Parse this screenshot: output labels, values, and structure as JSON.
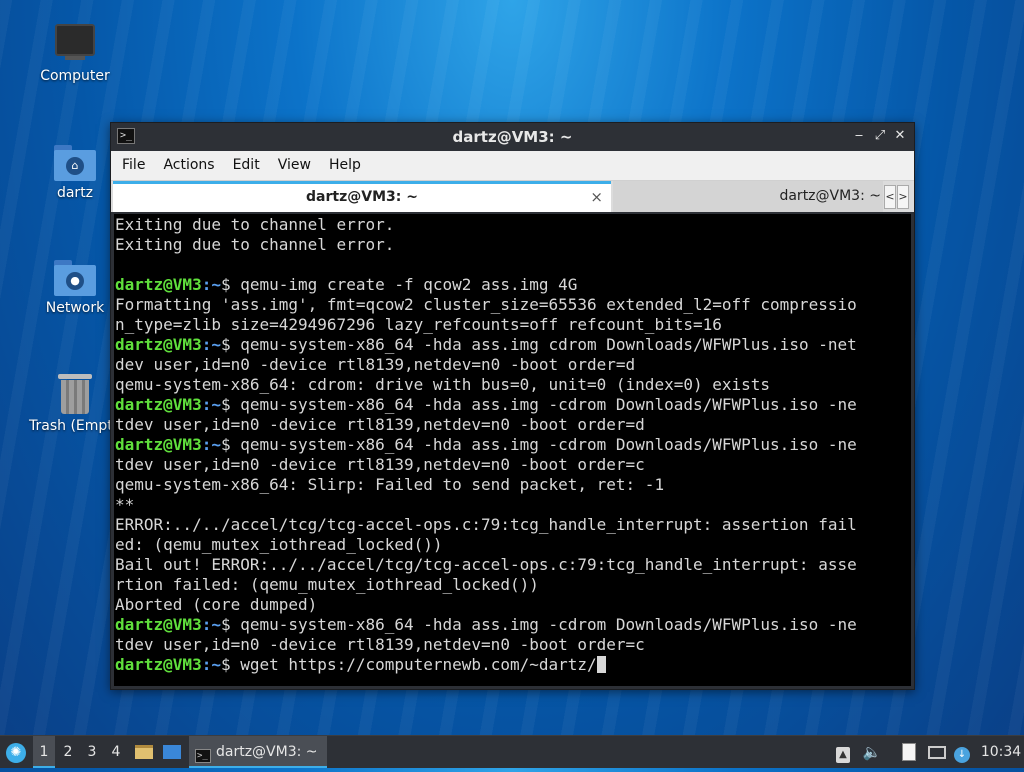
{
  "desktop": {
    "icons": [
      {
        "label": "Computer",
        "icon": "computer-icon"
      },
      {
        "label": "dartz",
        "icon": "home-folder-icon"
      },
      {
        "label": "Network",
        "icon": "network-folder-icon"
      },
      {
        "label": "Trash (Empt",
        "icon": "trash-icon"
      }
    ]
  },
  "window": {
    "title": "dartz@VM3: ~",
    "icon": "terminal-icon",
    "controls": {
      "minimize": "‒",
      "maximize": "⤢",
      "close": "✕"
    },
    "menu": [
      "File",
      "Actions",
      "Edit",
      "View",
      "Help"
    ],
    "tabs": [
      {
        "label": "dartz@VM3: ~",
        "active": true,
        "close": "×"
      },
      {
        "label": "dartz@VM3: ~",
        "active": false
      }
    ],
    "tab_scroll": {
      "left": "<",
      "right": ">"
    }
  },
  "terminal": {
    "prompt_user": "dartz@VM3",
    "prompt_path": ":~",
    "prompt_sign": "$",
    "colors": {
      "user": "#60e03c",
      "path": "#5aa0f0",
      "text": "#d7d7d7",
      "background": "#000000"
    },
    "lines": [
      {
        "type": "out",
        "text": "Exiting due to channel error."
      },
      {
        "type": "out",
        "text": "Exiting due to channel error."
      },
      {
        "type": "out",
        "text": ""
      },
      {
        "type": "cmd",
        "text": " qemu-img create -f qcow2 ass.img 4G"
      },
      {
        "type": "out",
        "text": "Formatting 'ass.img', fmt=qcow2 cluster_size=65536 extended_l2=off compressio"
      },
      {
        "type": "out",
        "text": "n_type=zlib size=4294967296 lazy_refcounts=off refcount_bits=16"
      },
      {
        "type": "cmd",
        "text": " qemu-system-x86_64 -hda ass.img cdrom Downloads/WFWPlus.iso -net"
      },
      {
        "type": "out",
        "text": "dev user,id=n0 -device rtl8139,netdev=n0 -boot order=d"
      },
      {
        "type": "out",
        "text": "qemu-system-x86_64: cdrom: drive with bus=0, unit=0 (index=0) exists"
      },
      {
        "type": "cmd",
        "text": " qemu-system-x86_64 -hda ass.img -cdrom Downloads/WFWPlus.iso -ne"
      },
      {
        "type": "out",
        "text": "tdev user,id=n0 -device rtl8139,netdev=n0 -boot order=d"
      },
      {
        "type": "cmd",
        "text": " qemu-system-x86_64 -hda ass.img -cdrom Downloads/WFWPlus.iso -ne"
      },
      {
        "type": "out",
        "text": "tdev user,id=n0 -device rtl8139,netdev=n0 -boot order=c"
      },
      {
        "type": "out",
        "text": "qemu-system-x86_64: Slirp: Failed to send packet, ret: -1"
      },
      {
        "type": "out",
        "text": "**"
      },
      {
        "type": "out",
        "text": "ERROR:../../accel/tcg/tcg-accel-ops.c:79:tcg_handle_interrupt: assertion fail"
      },
      {
        "type": "out",
        "text": "ed: (qemu_mutex_iothread_locked())"
      },
      {
        "type": "out",
        "text": "Bail out! ERROR:../../accel/tcg/tcg-accel-ops.c:79:tcg_handle_interrupt: asse"
      },
      {
        "type": "out",
        "text": "rtion failed: (qemu_mutex_iothread_locked())"
      },
      {
        "type": "out",
        "text": "Aborted (core dumped)"
      },
      {
        "type": "cmd",
        "text": " qemu-system-x86_64 -hda ass.img -cdrom Downloads/WFWPlus.iso -ne"
      },
      {
        "type": "out",
        "text": "tdev user,id=n0 -device rtl8139,netdev=n0 -boot order=c"
      },
      {
        "type": "cmd",
        "text": " wget https://computernewb.com/~dartz/",
        "cursor": true
      }
    ]
  },
  "taskbar": {
    "start_icon": "menu-logo-icon",
    "workspaces": [
      "1",
      "2",
      "3",
      "4"
    ],
    "active_workspace": "1",
    "quicklaunch": [
      "file-manager-icon",
      "show-desktop-icon"
    ],
    "task": {
      "label": "dartz@VM3: ~",
      "icon": "terminal-icon"
    },
    "tray": [
      "removable-media-icon",
      "volume-icon",
      "clipboard-icon",
      "network-icon",
      "update-icon"
    ],
    "clock": "10:34",
    "accent": "#3daee9"
  }
}
